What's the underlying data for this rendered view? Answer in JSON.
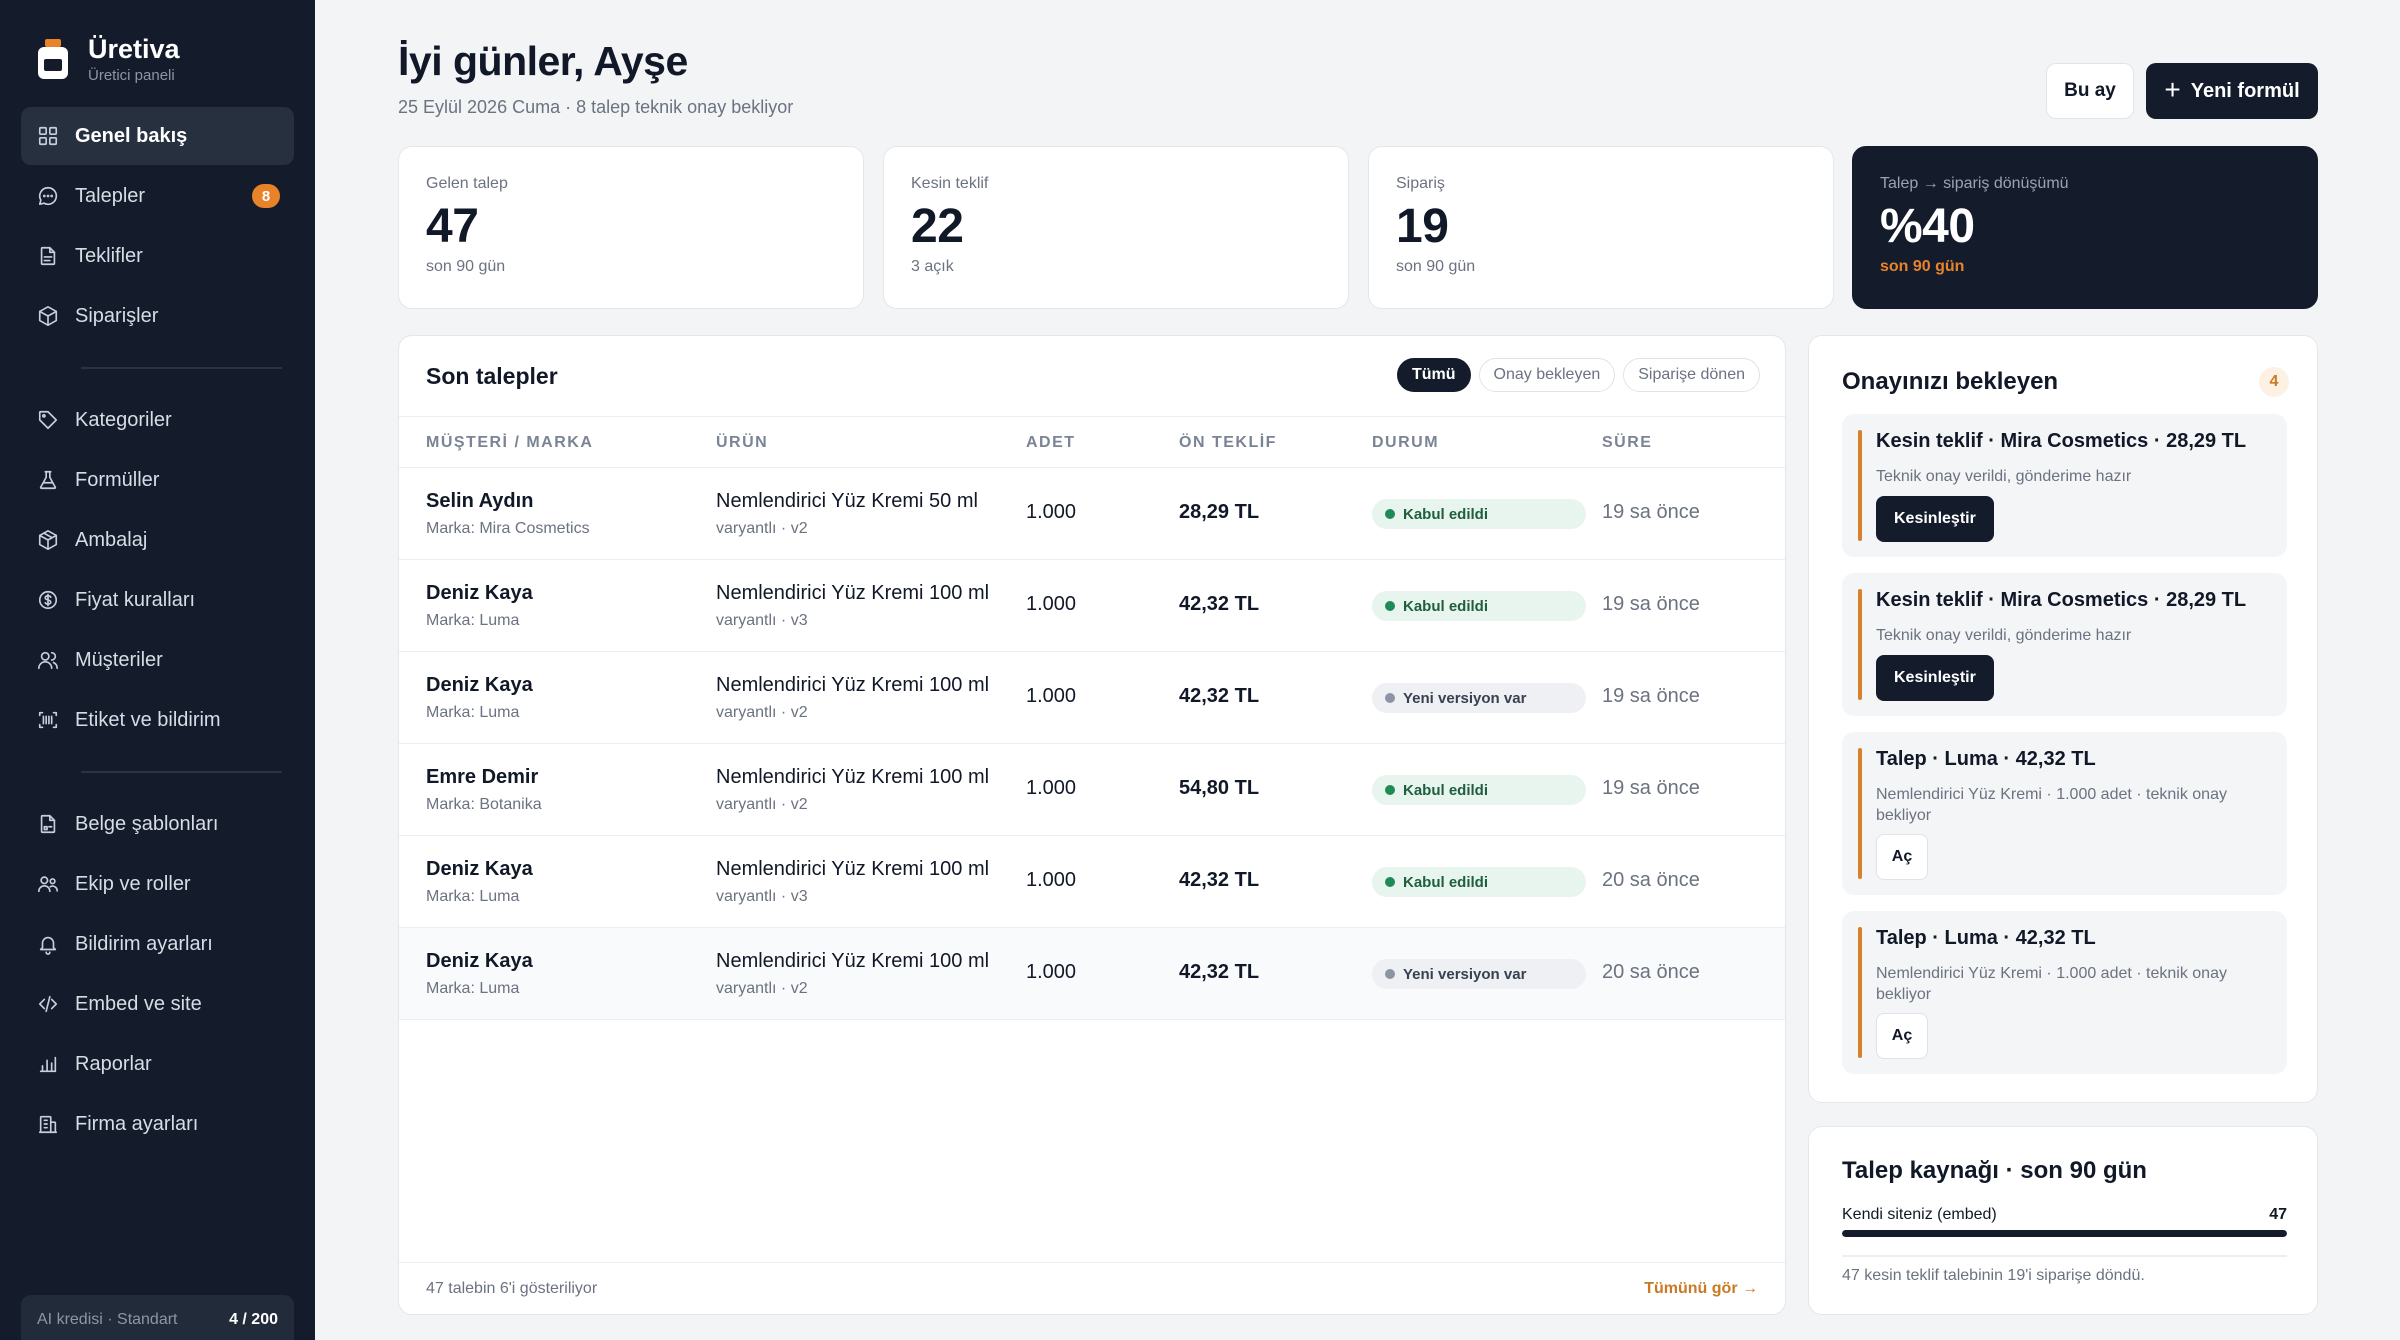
{
  "brand": {
    "name": "Üretiva",
    "subtitle": "Üretici paneli"
  },
  "sidebar": {
    "items": [
      {
        "label": "Genel bakış",
        "icon": "grid-icon",
        "active": true
      },
      {
        "label": "Talepler",
        "icon": "chat-icon",
        "badge": "8"
      },
      {
        "label": "Teklifler",
        "icon": "document-icon"
      },
      {
        "label": "Siparişler",
        "icon": "box-icon"
      },
      {
        "label": "Kategoriler",
        "icon": "tag-icon"
      },
      {
        "label": "Formüller",
        "icon": "flask-icon"
      },
      {
        "label": "Ambalaj",
        "icon": "package-icon"
      },
      {
        "label": "Fiyat kuralları",
        "icon": "coin-icon"
      },
      {
        "label": "Müşteriler",
        "icon": "users-icon"
      },
      {
        "label": "Etiket ve bildirim",
        "icon": "barcode-icon"
      },
      {
        "label": "Belge şablonları",
        "icon": "doc-template-icon"
      },
      {
        "label": "Ekip ve roller",
        "icon": "team-icon"
      },
      {
        "label": "Bildirim ayarları",
        "icon": "bell-icon"
      },
      {
        "label": "Embed ve site",
        "icon": "code-icon"
      },
      {
        "label": "Raporlar",
        "icon": "chart-icon"
      },
      {
        "label": "Firma ayarları",
        "icon": "building-icon"
      }
    ],
    "credit": {
      "label": "AI kredisi · Standart",
      "value": "4 / 200"
    }
  },
  "header": {
    "greeting": "İyi günler, Ayşe",
    "subtitle": "25 Eylül 2026 Cuma · 8 talep teknik onay bekliyor",
    "period_button": "Bu ay",
    "new_button": "Yeni formül"
  },
  "stats": [
    {
      "label": "Gelen talep",
      "value": "47",
      "foot": "son 90 gün"
    },
    {
      "label": "Kesin teklif",
      "value": "22",
      "foot": "3 açık"
    },
    {
      "label": "Sipariş",
      "value": "19",
      "foot": "son 90 gün"
    },
    {
      "label": "Talep → sipariş dönüşümü",
      "value": "%40",
      "foot": "son 90 gün"
    }
  ],
  "requests": {
    "title": "Son talepler",
    "filters": [
      "Tümü",
      "Onay bekleyen",
      "Siparişe dönen"
    ],
    "columns": [
      "MÜŞTERİ / MARKA",
      "ÜRÜN",
      "ADET",
      "ÖN TEKLİF",
      "DURUM",
      "SÜRE"
    ],
    "rows": [
      {
        "name": "Selin Aydın",
        "brand": "Marka: Mira Cosmetics",
        "product": "Nemlendirici Yüz Kremi 50 ml",
        "variant": "varyantlı · v2",
        "qty": "1.000",
        "price": "28,29 TL",
        "status": "Kabul edildi",
        "status_kind": "ok",
        "time": "19 sa önce"
      },
      {
        "name": "Deniz Kaya",
        "brand": "Marka: Luma",
        "product": "Nemlendirici Yüz Kremi 100 ml",
        "variant": "varyantlı · v3",
        "qty": "1.000",
        "price": "42,32 TL",
        "status": "Kabul edildi",
        "status_kind": "ok",
        "time": "19 sa önce"
      },
      {
        "name": "Deniz Kaya",
        "brand": "Marka: Luma",
        "product": "Nemlendirici Yüz Kremi 100 ml",
        "variant": "varyantlı · v2",
        "qty": "1.000",
        "price": "42,32 TL",
        "status": "Yeni versiyon var",
        "status_kind": "new",
        "time": "19 sa önce"
      },
      {
        "name": "Emre Demir",
        "brand": "Marka: Botanika",
        "product": "Nemlendirici Yüz Kremi 100 ml",
        "variant": "varyantlı · v2",
        "qty": "1.000",
        "price": "54,80 TL",
        "status": "Kabul edildi",
        "status_kind": "ok",
        "time": "19 sa önce"
      },
      {
        "name": "Deniz Kaya",
        "brand": "Marka: Luma",
        "product": "Nemlendirici Yüz Kremi 100 ml",
        "variant": "varyantlı · v3",
        "qty": "1.000",
        "price": "42,32 TL",
        "status": "Kabul edildi",
        "status_kind": "ok",
        "time": "20 sa önce"
      },
      {
        "name": "Deniz Kaya",
        "brand": "Marka: Luma",
        "product": "Nemlendirici Yüz Kremi 100 ml",
        "variant": "varyantlı · v2",
        "qty": "1.000",
        "price": "42,32 TL",
        "status": "Yeni versiyon var",
        "status_kind": "new",
        "time": "20 sa önce"
      }
    ],
    "footer_count": "47 talebin 6'i gösteriliyor",
    "footer_link": "Tümünü gör →"
  },
  "approvals": {
    "title": "Onayınızı bekleyen",
    "count": "4",
    "cards": [
      {
        "title": "Kesin teklif · Mira Cosmetics · 28,29 TL",
        "desc": "Teknik onay verildi, gönderime hazır",
        "button": "Kesinleştir",
        "button_kind": "dark"
      },
      {
        "title": "Kesin teklif · Mira Cosmetics · 28,29 TL",
        "desc": "Teknik onay verildi, gönderime hazır",
        "button": "Kesinleştir",
        "button_kind": "dark"
      },
      {
        "title": "Talep · Luma · 42,32 TL",
        "desc": "Nemlendirici Yüz Kremi · 1.000 adet · teknik onay bekliyor",
        "button": "Aç",
        "button_kind": "light"
      },
      {
        "title": "Talep · Luma · 42,32 TL",
        "desc": "Nemlendirici Yüz Kremi · 1.000 adet · teknik onay bekliyor",
        "button": "Aç",
        "button_kind": "light"
      }
    ]
  },
  "source": {
    "title": "Talep kaynağı · son 90 gün",
    "label": "Kendi siteniz (embed)",
    "value": "47",
    "share": 1.0,
    "note": "47 kesin teklif talebinin 19'i siparişe döndü."
  },
  "colors": {
    "sidebar_bg": "#141c2c",
    "accent": "#e8832a",
    "success": "#1f8a55"
  }
}
